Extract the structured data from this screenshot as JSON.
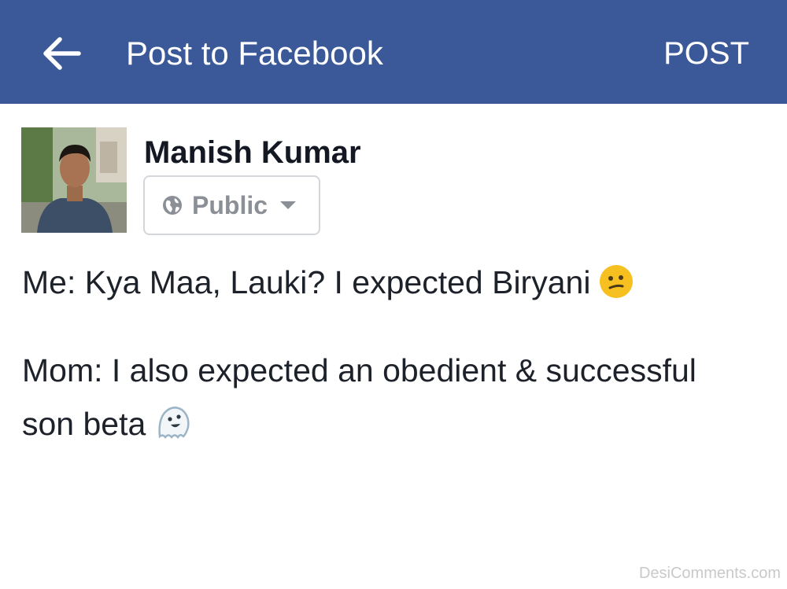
{
  "header": {
    "title": "Post to Facebook",
    "post_label": "POST",
    "back_icon": "arrow-left-icon",
    "background_color": "#3b5998"
  },
  "composer": {
    "user_name": "Manish Kumar",
    "privacy": {
      "label": "Public",
      "icon": "globe-icon",
      "dropdown_icon": "caret-down-icon"
    },
    "post_lines": [
      "Me: Kya Maa, Lauki? I expected Biryani",
      "Mom: I also expected an obedient & successful",
      "son beta"
    ],
    "emojis": [
      "confused-face-emoji-icon",
      "ghost-emoji-icon"
    ]
  },
  "watermark": "DesiComments.com"
}
